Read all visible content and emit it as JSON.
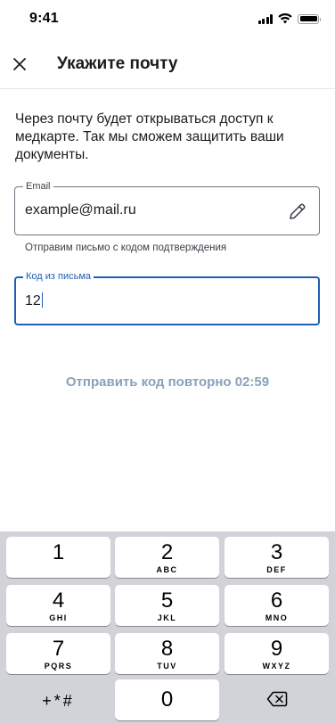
{
  "status_bar": {
    "time": "9:41"
  },
  "header": {
    "title": "Укажите почту",
    "close_icon": "close-icon"
  },
  "description": "Через почту будет открываться доступ к медкарте. Так мы сможем защитить ваши документы.",
  "email_field": {
    "label": "Email",
    "value": "example@mail.ru",
    "edit_icon": "pencil-icon"
  },
  "email_hint": "Отправим письмо с кодом подтверждения",
  "code_field": {
    "label": "Код из письма",
    "value": "12"
  },
  "resend": {
    "label": "Отправить код повторно 02:59"
  },
  "colors": {
    "accent": "#1f5fb5",
    "resend_disabled": "#8aa1ba",
    "keyboard_bg": "#d1d3d9"
  },
  "keyboard": {
    "keys": [
      {
        "num": "1",
        "letters": ""
      },
      {
        "num": "2",
        "letters": "ABC"
      },
      {
        "num": "3",
        "letters": "DEF"
      },
      {
        "num": "4",
        "letters": "GHI"
      },
      {
        "num": "5",
        "letters": "JKL"
      },
      {
        "num": "6",
        "letters": "MNO"
      },
      {
        "num": "7",
        "letters": "PQRS"
      },
      {
        "num": "8",
        "letters": "TUV"
      },
      {
        "num": "9",
        "letters": "WXYZ"
      }
    ],
    "symbols": "+*#",
    "zero": "0",
    "backspace_icon": "backspace-icon"
  }
}
